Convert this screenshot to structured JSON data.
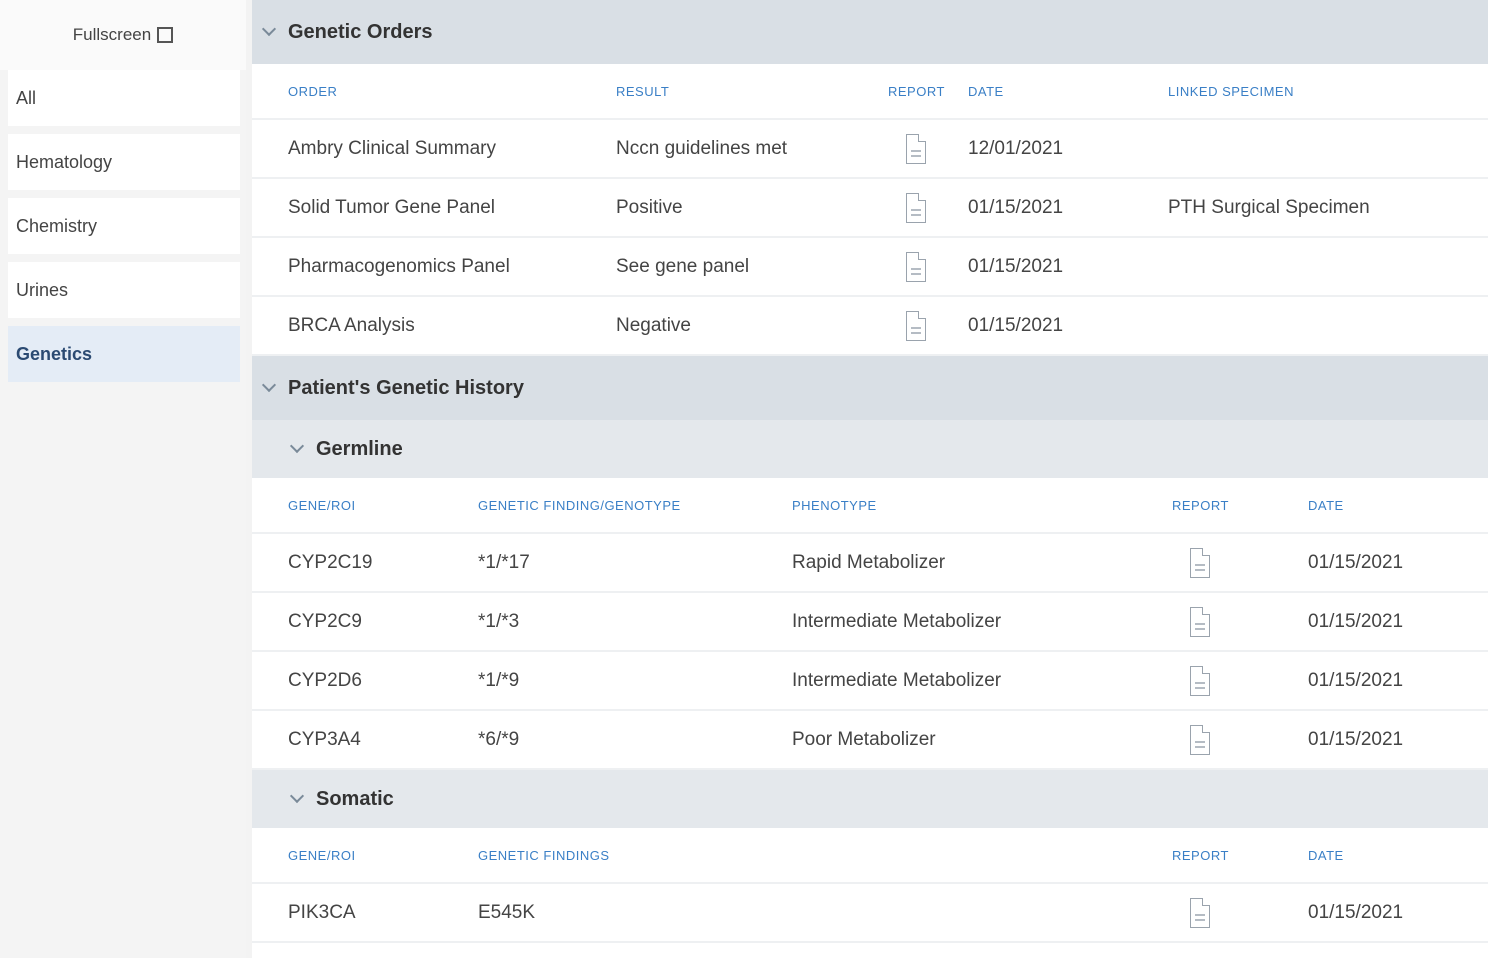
{
  "sidebar": {
    "fullscreen_label": "Fullscreen",
    "items": [
      {
        "label": "All"
      },
      {
        "label": "Hematology"
      },
      {
        "label": "Chemistry"
      },
      {
        "label": "Urines"
      },
      {
        "label": "Genetics"
      }
    ]
  },
  "genetic_orders": {
    "title": "Genetic Orders",
    "columns": [
      "ORDER",
      "RESULT",
      "REPORT",
      "DATE",
      "LINKED SPECIMEN"
    ],
    "rows": [
      {
        "order": "Ambry Clinical Summary",
        "result": "Nccn guidelines met",
        "date": "12/01/2021",
        "specimen": ""
      },
      {
        "order": "Solid Tumor Gene Panel",
        "result": "Positive",
        "date": "01/15/2021",
        "specimen": "PTH Surgical Specimen"
      },
      {
        "order": "Pharmacogenomics Panel",
        "result": "See gene panel",
        "date": "01/15/2021",
        "specimen": ""
      },
      {
        "order": "BRCA Analysis",
        "result": "Negative",
        "date": "01/15/2021",
        "specimen": ""
      }
    ]
  },
  "history": {
    "title": "Patient's Genetic History",
    "germline": {
      "title": "Germline",
      "columns": [
        "GENE/ROI",
        "GENETIC FINDING/GENOTYPE",
        "PHENOTYPE",
        "REPORT",
        "DATE"
      ],
      "rows": [
        {
          "gene": "CYP2C19",
          "finding": "*1/*17",
          "phenotype": "Rapid Metabolizer",
          "date": "01/15/2021"
        },
        {
          "gene": "CYP2C9",
          "finding": "*1/*3",
          "phenotype": "Intermediate Metabolizer",
          "date": "01/15/2021"
        },
        {
          "gene": "CYP2D6",
          "finding": "*1/*9",
          "phenotype": "Intermediate Metabolizer",
          "date": "01/15/2021"
        },
        {
          "gene": "CYP3A4",
          "finding": "*6/*9",
          "phenotype": "Poor Metabolizer",
          "date": "01/15/2021"
        }
      ]
    },
    "somatic": {
      "title": "Somatic",
      "columns": [
        "GENE/ROI",
        "GENETIC FINDINGS",
        "REPORT",
        "DATE"
      ],
      "rows": [
        {
          "gene": "PIK3CA",
          "finding": "E545K",
          "date": "01/15/2021"
        }
      ]
    }
  }
}
